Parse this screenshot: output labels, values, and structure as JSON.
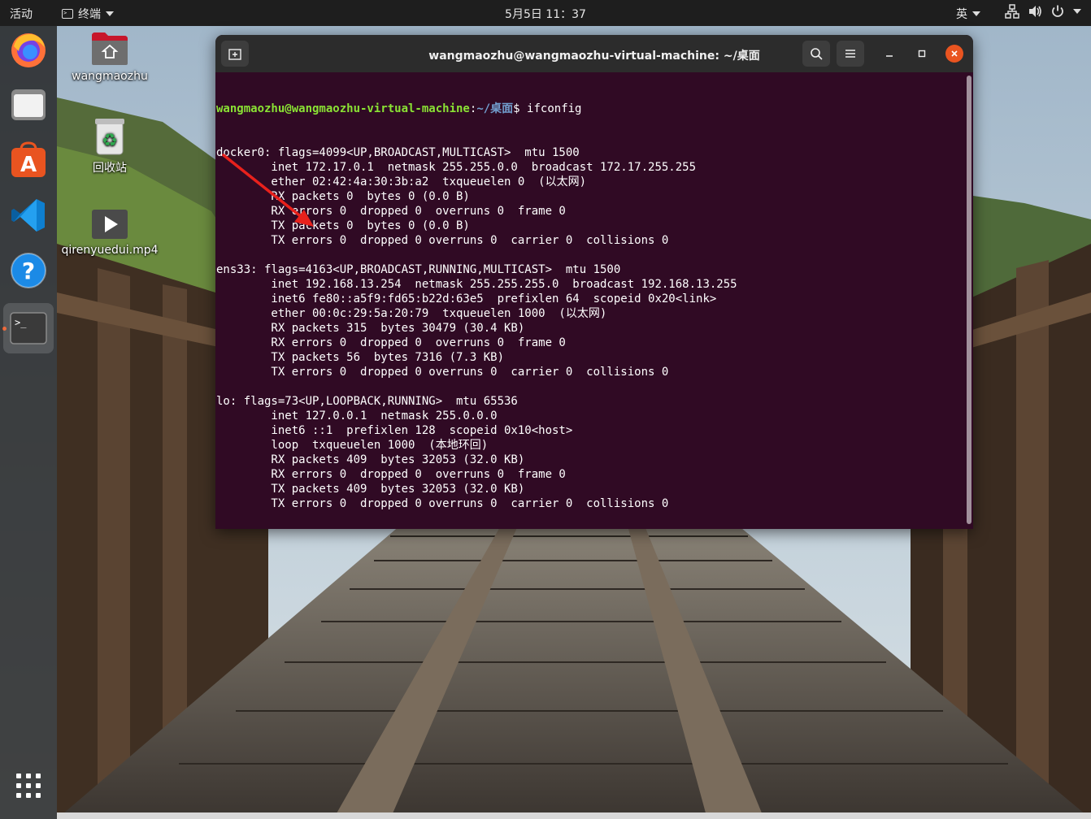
{
  "topbar": {
    "activities": "活动",
    "app_menu": "终端",
    "clock": "5月5日  11：37",
    "input_method": "英"
  },
  "dock": {
    "items": [
      "firefox-icon",
      "files-icon",
      "software-icon",
      "vscode-icon",
      "help-icon",
      "terminal-icon"
    ],
    "show_apps": "grid-icon"
  },
  "desktop": {
    "icons": [
      {
        "label": "wangmaozhu",
        "icon": "home-folder-icon"
      },
      {
        "label": "回收站",
        "icon": "trash-icon"
      },
      {
        "label": "qirenyuedui.mp4",
        "icon": "video-file-icon"
      }
    ]
  },
  "terminal": {
    "title": "wangmaozhu@wangmaozhu-virtual-machine: ~/桌面",
    "prompt_user": "wangmaozhu@wangmaozhu-virtual-machine",
    "prompt_path": "~/桌面",
    "prompt_sep": ":",
    "prompt_end": "$",
    "command": "ifconfig",
    "output": [
      "docker0: flags=4099<UP,BROADCAST,MULTICAST>  mtu 1500",
      "        inet 172.17.0.1  netmask 255.255.0.0  broadcast 172.17.255.255",
      "        ether 02:42:4a:30:3b:a2  txqueuelen 0  (以太网)",
      "        RX packets 0  bytes 0 (0.0 B)",
      "        RX errors 0  dropped 0  overruns 0  frame 0",
      "        TX packets 0  bytes 0 (0.0 B)",
      "        TX errors 0  dropped 0 overruns 0  carrier 0  collisions 0",
      "",
      "ens33: flags=4163<UP,BROADCAST,RUNNING,MULTICAST>  mtu 1500",
      "        inet 192.168.13.254  netmask 255.255.255.0  broadcast 192.168.13.255",
      "        inet6 fe80::a5f9:fd65:b22d:63e5  prefixlen 64  scopeid 0x20<link>",
      "        ether 00:0c:29:5a:20:79  txqueuelen 1000  (以太网)",
      "        RX packets 315  bytes 30479 (30.4 KB)",
      "        RX errors 0  dropped 0  overruns 0  frame 0",
      "        TX packets 56  bytes 7316 (7.3 KB)",
      "        TX errors 0  dropped 0 overruns 0  carrier 0  collisions 0",
      "",
      "lo: flags=73<UP,LOOPBACK,RUNNING>  mtu 65536",
      "        inet 127.0.0.1  netmask 255.0.0.0",
      "        inet6 ::1  prefixlen 128  scopeid 0x10<host>",
      "        loop  txqueuelen 1000  (本地环回)",
      "        RX packets 409  bytes 32053 (32.0 KB)",
      "        RX errors 0  dropped 0  overruns 0  frame 0",
      "        TX packets 409  bytes 32053 (32.0 KB)",
      "        TX errors 0  dropped 0 overruns 0  carrier 0  collisions 0",
      ""
    ]
  },
  "colors": {
    "terminal_bg": "#300a24",
    "prompt_user": "#8ae234",
    "prompt_path": "#729fcf",
    "accent": "#e95420",
    "annotation_arrow": "#e8211c"
  }
}
